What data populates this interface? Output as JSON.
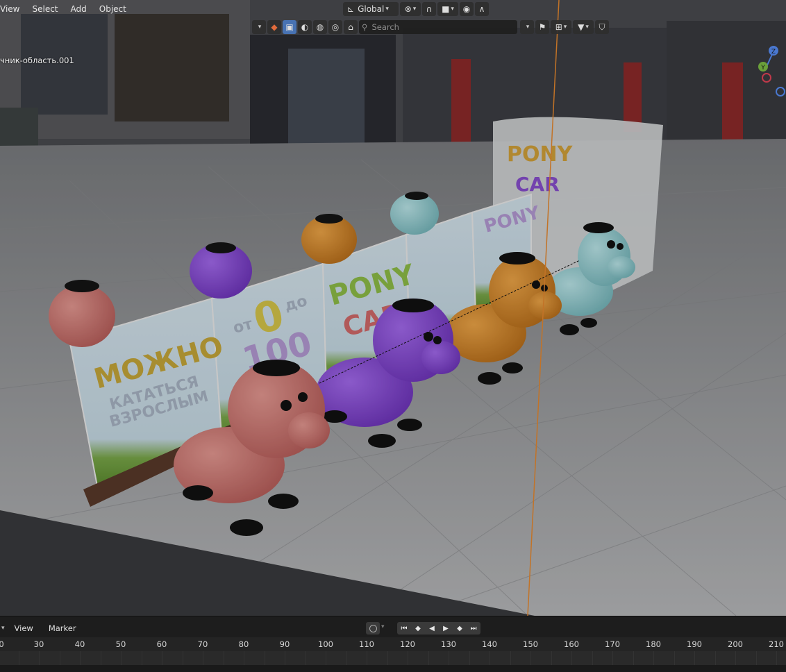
{
  "header": {
    "menus": [
      "View",
      "Select",
      "Add",
      "Object"
    ],
    "active_object": "чник-область.001"
  },
  "toolbar": {
    "orientation": "Global",
    "search_placeholder": "Search",
    "icons": [
      "transform-orientation-icon",
      "snap-icon",
      "proportional-edit-icon",
      "viewport-shading-solid-icon",
      "overlay-icon",
      "outliner-filter-icon",
      "bookmark-icon",
      "display-mode-icon",
      "filter-icon",
      "shield-icon"
    ]
  },
  "scene": {
    "signs": {
      "front_word": "МОЖНО",
      "front_sub1": "КАТАТЬСЯ",
      "front_sub2": "ВЗРОСЛЫМ",
      "middle_from": "от",
      "middle_zero": "0",
      "middle_to": "до",
      "middle_num": "100",
      "pony": "PONY",
      "car": "CAR"
    },
    "booth": {
      "pony": "PONY",
      "car": "CAR"
    },
    "colors": {
      "pink": "#d2726f",
      "purple": "#8b48d8",
      "orange": "#d98b2c",
      "cyan": "#96d3d8",
      "object_line": "#e8892f"
    }
  },
  "gizmo": {
    "axes": [
      "Z",
      "Y"
    ]
  },
  "timeline": {
    "menus": [
      "View",
      "Marker"
    ],
    "ruler": [
      "30",
      "40",
      "50",
      "60",
      "70",
      "80",
      "90",
      "100",
      "110",
      "120",
      "130",
      "140",
      "150",
      "160",
      "170",
      "180",
      "190",
      "200",
      "210"
    ],
    "ruler_first": "0"
  }
}
